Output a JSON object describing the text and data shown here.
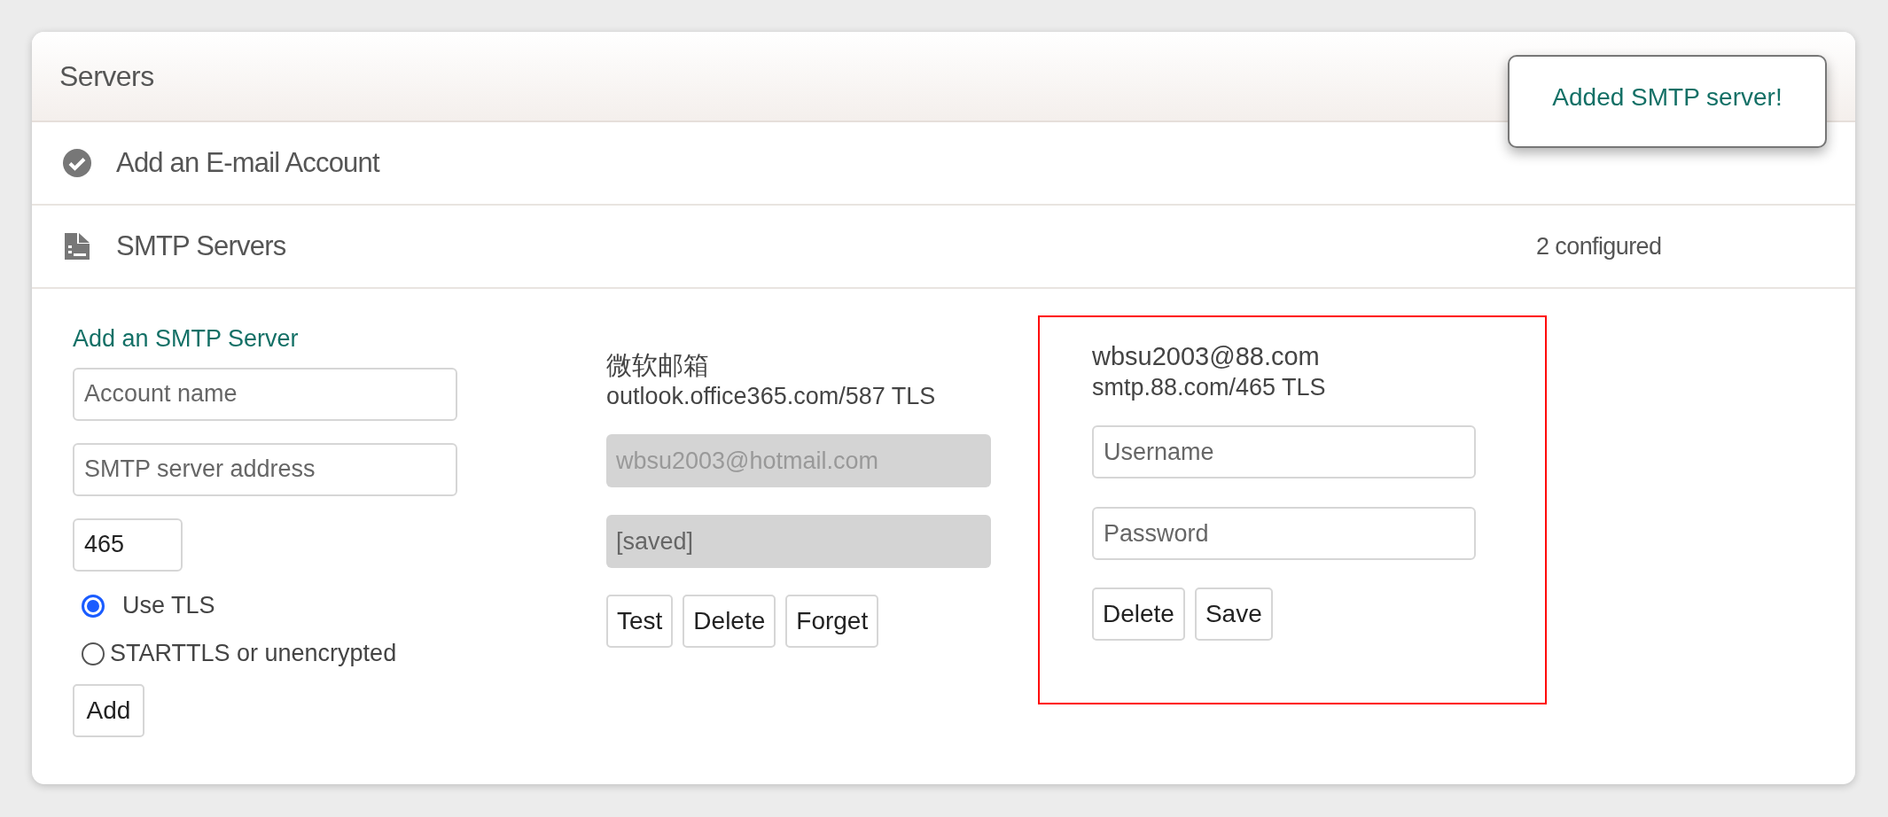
{
  "panel": {
    "title": "Servers"
  },
  "toast": {
    "text": "Added SMTP server!"
  },
  "sections": [
    {
      "kind": "check",
      "title": "Add an E-mail Account"
    },
    {
      "kind": "document",
      "title": "SMTP Servers",
      "summary": "2 configured"
    }
  ],
  "add_form": {
    "heading": "Add an SMTP Server",
    "fields": [
      {
        "placeholder": "Account name",
        "kind": "text"
      },
      {
        "placeholder": "SMTP server address",
        "kind": "text"
      },
      {
        "value": "465",
        "kind": "number"
      }
    ],
    "options": [
      {
        "label": "Use TLS",
        "selected": true
      },
      {
        "label": "STARTTLS or unencrypted",
        "selected": false
      }
    ],
    "button": "Add"
  },
  "servers": [
    {
      "name": "微软邮箱",
      "address": "outlook.office365.com/587 TLS",
      "highlighted": false,
      "fields": [
        {
          "value": "wbsu2003@hotmail.com",
          "disabled": true
        },
        {
          "placeholder": "[saved]",
          "disabled": true
        }
      ],
      "buttons": [
        "Test",
        "Delete",
        "Forget"
      ]
    },
    {
      "name": "wbsu2003@88.com",
      "address": "smtp.88.com/465 TLS",
      "highlighted": true,
      "fields": [
        {
          "placeholder": "Username",
          "disabled": false
        },
        {
          "placeholder": "Password",
          "disabled": false
        }
      ],
      "buttons": [
        "Delete",
        "Save"
      ]
    }
  ]
}
